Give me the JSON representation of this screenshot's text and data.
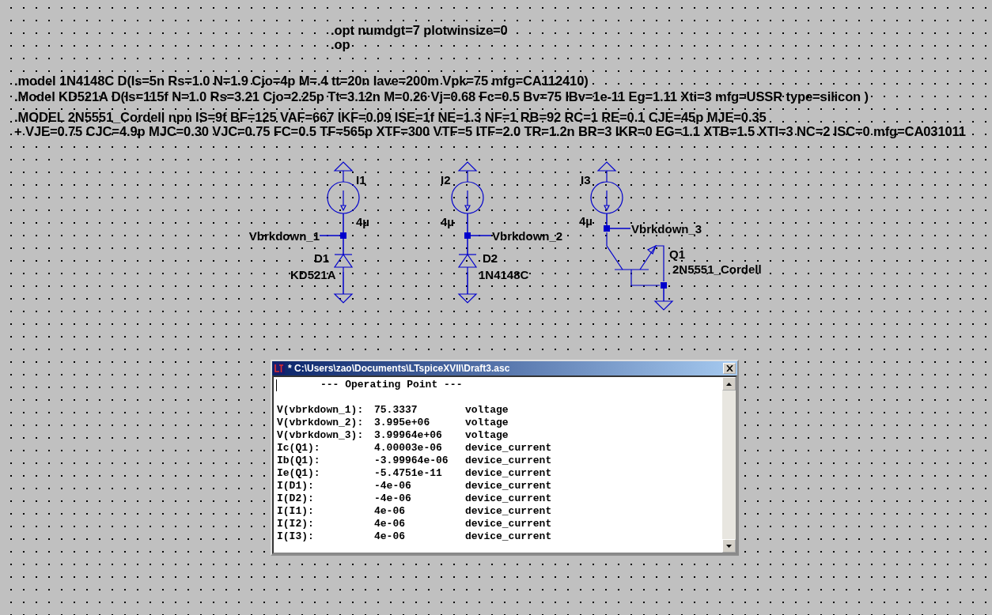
{
  "directives": [
    {
      "lines": [
        ".opt numdgt=7 plotwinsize=0",
        ".op"
      ]
    },
    {
      "lines": [
        ".model 1N4148C D(Is=5n Rs=1.0 N=1.9 Cjo=4p M=.4 tt=20n Iave=200m Vpk=75 mfg=CA112410)"
      ]
    },
    {
      "lines": [
        ".Model KD521A D(Is=115f N=1.0 Rs=3.21 Cjo=2.25p Tt=3.12n M=0.26 Vj=0.68 Fc=0.5 Bv=75 IBv=1e-11 Eg=1.11 Xti=3 mfg=USSR type=silicon )"
      ]
    },
    {
      "lines": [
        ".MODEL 2N5551_Cordell npn IS=9f BF=125 VAF=667 IKF=0.09 ISE=1f NE=1.3 NF=1 RB=92 RC=1 RE=0.1 CJE=45p MJE=0.35",
        "+ VJE=0.75 CJC=4.9p MJC=0.30 VJC=0.75 FC=0.5 TF=565p XTF=300 VTF=5 ITF=2.0 TR=1.2n BR=3 IKR=0 EG=1.1 XTB=1.5 XTI=3 NC=2 ISC=0 mfg=CA031011"
      ]
    }
  ],
  "circuits": [
    {
      "kind": "diode",
      "source": {
        "name": "I1",
        "value": "4µ"
      },
      "net_label": "Vbrkdown_1",
      "device": {
        "name": "D1",
        "model": "KD521A"
      }
    },
    {
      "kind": "diode",
      "source": {
        "name": "I2",
        "value": "4µ"
      },
      "net_label": "Vbrkdown_2",
      "device": {
        "name": "D2",
        "model": "1N4148C"
      }
    },
    {
      "kind": "npn",
      "source": {
        "name": "I3",
        "value": "4µ"
      },
      "net_label": "Vbrkdown_3",
      "device": {
        "name": "Q1",
        "model": "2N5551_Cordell"
      }
    }
  ],
  "output_window": {
    "title": "* C:\\Users\\zao\\Documents\\LTspiceXVII\\Draft3.asc",
    "heading": "--- Operating Point ---",
    "rows": [
      {
        "name": "V(vbrkdown_1):",
        "value": "75.3337",
        "type": "voltage"
      },
      {
        "name": "V(vbrkdown_2):",
        "value": "3.995e+06",
        "type": "voltage"
      },
      {
        "name": "V(vbrkdown_3):",
        "value": "3.99964e+06",
        "type": "voltage"
      },
      {
        "name": "Ic(Q1):",
        "value": "4.00003e-06",
        "type": "device_current"
      },
      {
        "name": "Ib(Q1):",
        "value": "-3.99964e-06",
        "type": "device_current"
      },
      {
        "name": "Ie(Q1):",
        "value": "-5.4751e-11",
        "type": "device_current"
      },
      {
        "name": "I(D1):",
        "value": "-4e-06",
        "type": "device_current"
      },
      {
        "name": "I(D2):",
        "value": "-4e-06",
        "type": "device_current"
      },
      {
        "name": "I(I1):",
        "value": "4e-06",
        "type": "device_current"
      },
      {
        "name": "I(I2):",
        "value": "4e-06",
        "type": "device_current"
      },
      {
        "name": "I(I3):",
        "value": "4e-06",
        "type": "device_current"
      }
    ]
  }
}
